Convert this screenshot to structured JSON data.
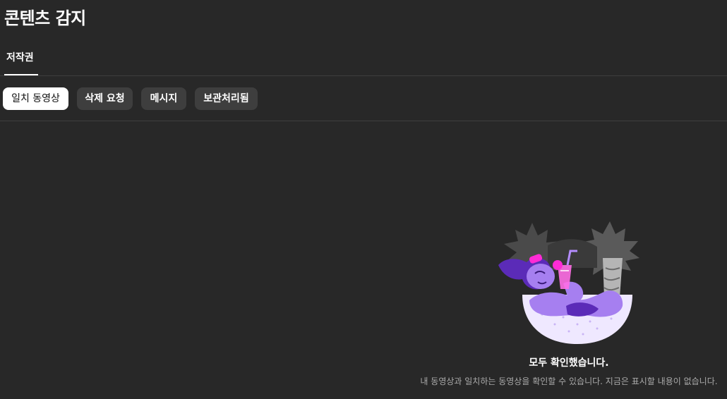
{
  "header": {
    "title": "콘텐츠 감지"
  },
  "tabs": [
    {
      "label": "저작권",
      "active": true
    }
  ],
  "filters": [
    {
      "label": "일치 동영상",
      "selected": true
    },
    {
      "label": "삭제 요청",
      "selected": false
    },
    {
      "label": "메시지",
      "selected": false
    },
    {
      "label": "보관처리됨",
      "selected": false
    }
  ],
  "empty_state": {
    "illustration_icon": "relaxing-in-hammock-illustration",
    "title": "모두 확인했습니다.",
    "subtitle": "내 동영상과 일치하는 동영상을 확인할 수 있습니다. 지금은 표시할 내용이 없습니다."
  },
  "colors": {
    "background": "#282828",
    "chip_default": "#3e3e3e",
    "chip_selected": "#ffffff",
    "divider": "#3e3e3e",
    "illustration_purple": "#8a4fe0",
    "illustration_pink": "#ff2bd6"
  }
}
